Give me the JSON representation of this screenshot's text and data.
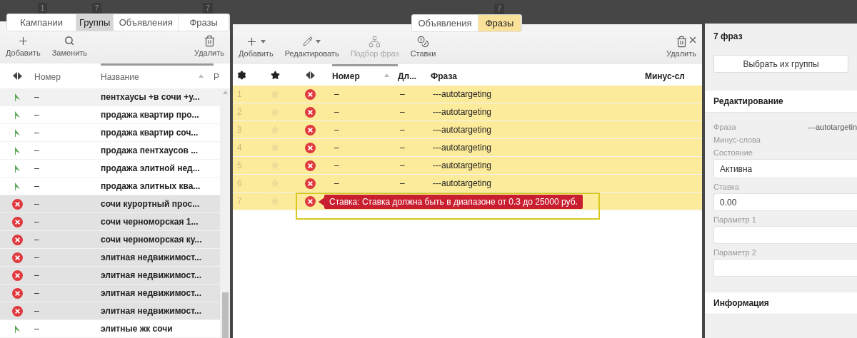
{
  "left_panel": {
    "tabs": [
      {
        "label": "Кампании",
        "badge": "1",
        "selected": false
      },
      {
        "label": "Группы",
        "badge": "7",
        "selected": true
      },
      {
        "label": "Объявления",
        "selected": false
      },
      {
        "label": "Фразы",
        "badge": "7",
        "selected": false
      }
    ],
    "toolbar": [
      {
        "kind": "add",
        "label": "Добавить",
        "disabled": false
      },
      {
        "kind": "replace",
        "label": "Заменить",
        "disabled": false
      },
      {
        "kind": "delete",
        "label": "Удалить",
        "disabled": false
      }
    ],
    "columns": [
      {
        "label": "Номер",
        "sorted": false
      },
      {
        "label": "Название",
        "sorted": true
      },
      {
        "label": "Р",
        "sorted": false
      }
    ],
    "rows": [
      {
        "stopped": false,
        "number": "–",
        "name": "пентхаусы +в сочи +у...",
        "highlighted": true
      },
      {
        "stopped": false,
        "number": "–",
        "name": "продажа квартир про...",
        "highlighted": false
      },
      {
        "stopped": false,
        "number": "–",
        "name": "продажа квартир соч...",
        "highlighted": false
      },
      {
        "stopped": false,
        "number": "–",
        "name": "продажа пентхаусов ...",
        "highlighted": false
      },
      {
        "stopped": false,
        "number": "–",
        "name": "продажа элитной нед...",
        "highlighted": false
      },
      {
        "stopped": false,
        "number": "–",
        "name": "продажа элитных ква...",
        "highlighted": false
      },
      {
        "stopped": true,
        "number": "–",
        "name": "сочи курортный прос...",
        "highlighted": true
      },
      {
        "stopped": true,
        "number": "–",
        "name": "сочи черноморская 1...",
        "highlighted": true
      },
      {
        "stopped": true,
        "number": "–",
        "name": "сочи черноморская ку...",
        "highlighted": true
      },
      {
        "stopped": true,
        "number": "–",
        "name": "элитная недвижимост...",
        "highlighted": true
      },
      {
        "stopped": true,
        "number": "–",
        "name": "элитная недвижимост...",
        "highlighted": true
      },
      {
        "stopped": true,
        "number": "–",
        "name": "элитная недвижимост...",
        "highlighted": true
      },
      {
        "stopped": true,
        "number": "–",
        "name": "элитная недвижимост...",
        "highlighted": true
      },
      {
        "stopped": false,
        "number": "–",
        "name": "элитные жк сочи",
        "highlighted": false
      }
    ]
  },
  "middle_panel": {
    "tabs": [
      {
        "label": "Объявления",
        "selected": false
      },
      {
        "label": "Фразы",
        "badge": "7",
        "selected": true
      }
    ],
    "toolbar": [
      {
        "kind": "add",
        "label": "Добавить",
        "dropdown": true,
        "disabled": false
      },
      {
        "kind": "edit",
        "label": "Редактировать",
        "dropdown": true,
        "disabled": false
      },
      {
        "kind": "pick",
        "label": "Подбор фраз",
        "dropdown": false,
        "disabled": true
      },
      {
        "kind": "bids",
        "label": "Ставки",
        "dropdown": false,
        "disabled": false
      },
      {
        "kind": "delete",
        "label": "Удалить",
        "dropdown": false,
        "disabled": false
      }
    ],
    "columns": [
      {
        "label": "Номер",
        "sorted": true
      },
      {
        "label": "Дл...",
        "sorted": false
      },
      {
        "label": "Фраза",
        "sorted": false
      },
      {
        "label": "Минус-сл",
        "sorted": false
      }
    ],
    "rows": [
      {
        "index": "1",
        "starred": false,
        "stopped": true,
        "number": "–",
        "length": "–",
        "phrase": "---autotargeting",
        "selected": true
      },
      {
        "index": "2",
        "starred": false,
        "stopped": true,
        "number": "–",
        "length": "–",
        "phrase": "---autotargeting",
        "selected": true
      },
      {
        "index": "3",
        "starred": false,
        "stopped": true,
        "number": "–",
        "length": "–",
        "phrase": "---autotargeting",
        "selected": true
      },
      {
        "index": "4",
        "starred": false,
        "stopped": true,
        "number": "–",
        "length": "–",
        "phrase": "---autotargeting",
        "selected": true
      },
      {
        "index": "5",
        "starred": false,
        "stopped": true,
        "number": "–",
        "length": "–",
        "phrase": "---autotargeting",
        "selected": true
      },
      {
        "index": "6",
        "starred": false,
        "stopped": true,
        "number": "–",
        "length": "–",
        "phrase": "---autotargeting",
        "selected": true
      },
      {
        "index": "7",
        "starred": false,
        "stopped": true,
        "error": "Ставка: Ставка должна быть в диапазоне от 0.3 до 25000 руб.",
        "selected": true
      }
    ]
  },
  "right_panel": {
    "title": "7 фраз",
    "button": "Выбрать их группы",
    "sections": [
      {
        "title": "Редактирование",
        "fields": [
          {
            "kind": "text",
            "label": "Фраза",
            "value": "---autotargetin"
          },
          {
            "kind": "text",
            "label": "Минус-слова"
          },
          {
            "kind": "select",
            "label": "Состояние",
            "value": "Активна"
          },
          {
            "kind": "input",
            "label": "Ставка",
            "value": "0.00"
          },
          {
            "kind": "input",
            "label": "Параметр 1"
          },
          {
            "kind": "input",
            "label": "Параметр 2"
          }
        ]
      },
      {
        "title": "Информация"
      }
    ]
  }
}
